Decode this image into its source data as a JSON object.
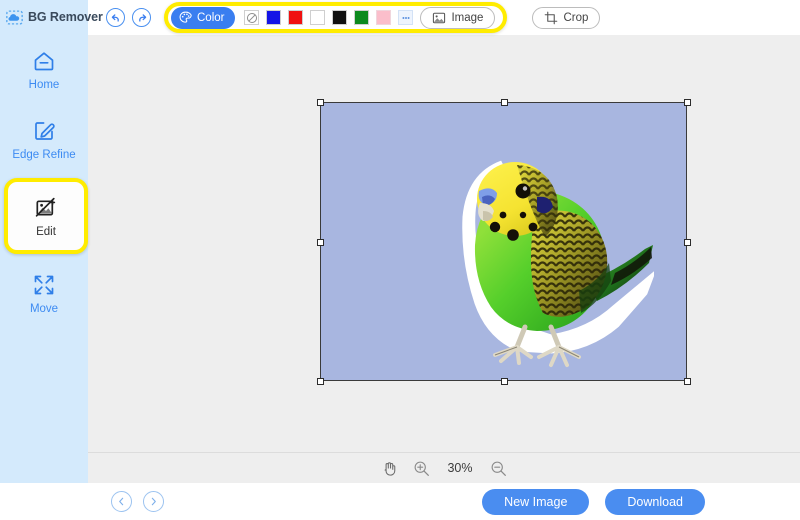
{
  "app": {
    "brand_name": "BG Remover",
    "logo_icon": "cloud-cutout-icon"
  },
  "sidebar": {
    "items": [
      {
        "id": "home",
        "label": "Home",
        "icon": "home-icon",
        "active": false
      },
      {
        "id": "edge-refine",
        "label": "Edge Refine",
        "icon": "pen-square-icon",
        "active": false
      },
      {
        "id": "edit",
        "label": "Edit",
        "icon": "image-edit-icon",
        "active": true
      },
      {
        "id": "move",
        "label": "Move",
        "icon": "move-arrows-icon",
        "active": false
      }
    ]
  },
  "toolbar": {
    "undo_icon": "undo-arrow-icon",
    "redo_icon": "redo-arrow-icon",
    "color_button": {
      "label": "Color",
      "icon": "palette-icon",
      "accent": "#3a7ef0"
    },
    "swatches": [
      {
        "name": "transparent",
        "color": "none",
        "icon": "no-color-icon"
      },
      {
        "name": "blue",
        "color": "#1414e6"
      },
      {
        "name": "red",
        "color": "#f01010"
      },
      {
        "name": "white",
        "color": "#ffffff"
      },
      {
        "name": "black",
        "color": "#111111"
      },
      {
        "name": "green",
        "color": "#0d8a1e"
      },
      {
        "name": "pink",
        "color": "#fbbecb"
      },
      {
        "name": "more",
        "color": "#eef4fd",
        "icon": "more-dots-icon"
      }
    ],
    "image_button": {
      "label": "Image",
      "icon": "picture-icon"
    },
    "crop_button": {
      "label": "Crop",
      "icon": "crop-icon"
    },
    "highlight_color": "#ffec00"
  },
  "canvas": {
    "background": "#eeeeee",
    "selection_fill": "#a8b6e0",
    "image_alt": "green-yellow-budgerigar-parakeet"
  },
  "zoombar": {
    "hand_icon": "hand-tool-icon",
    "zoom_in_icon": "zoom-in-icon",
    "zoom_out_icon": "zoom-out-icon",
    "zoom_level": "30%"
  },
  "bottombar": {
    "prev_icon": "chevron-left-icon",
    "next_icon": "chevron-right-icon",
    "new_image_label": "New Image",
    "download_label": "Download",
    "button_color": "#4a8df0"
  }
}
